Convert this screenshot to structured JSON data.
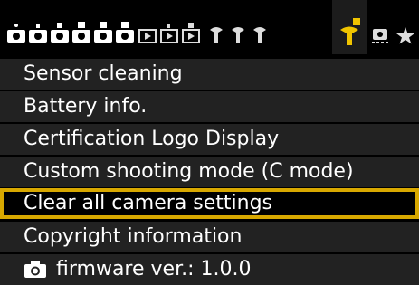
{
  "tabs": [
    {
      "icon": "camera-shooting-tab-icon",
      "index": "1",
      "selected": false
    },
    {
      "icon": "camera-shooting-tab-icon",
      "index": "2",
      "selected": false
    },
    {
      "icon": "camera-shooting-tab-icon",
      "index": "3",
      "selected": false
    },
    {
      "icon": "camera-shooting-tab-icon",
      "index": "4",
      "selected": false
    },
    {
      "icon": "camera-shooting-tab-icon",
      "index": "5",
      "selected": false
    },
    {
      "icon": "camera-shooting-tab-icon",
      "index": "6",
      "selected": false
    },
    {
      "icon": "playback-tab-icon",
      "index": "1",
      "selected": false
    },
    {
      "icon": "playback-tab-icon",
      "index": "2",
      "selected": false
    },
    {
      "icon": "playback-tab-icon",
      "index": "3",
      "selected": false
    },
    {
      "icon": "setup-tab-icon",
      "index": "1",
      "selected": false
    },
    {
      "icon": "setup-tab-icon",
      "index": "2",
      "selected": false
    },
    {
      "icon": "setup-tab-icon",
      "index": "3",
      "selected": false
    },
    {
      "icon": "setup-tab-icon",
      "index": "4",
      "selected": true
    },
    {
      "icon": "custom-functions-tab-icon",
      "index": "",
      "selected": false
    },
    {
      "icon": "my-menu-star-icon",
      "index": "",
      "selected": false
    }
  ],
  "menu": {
    "items": [
      {
        "label": "Sensor cleaning"
      },
      {
        "label": "Battery info."
      },
      {
        "label": "Certification Logo Display"
      },
      {
        "label": "Custom shooting mode (C mode)"
      },
      {
        "label": "Clear all camera settings",
        "selected": true
      },
      {
        "label": "Copyright information"
      },
      {
        "label": "firmware ver.: 1.0.0",
        "icon": "camera-icon"
      }
    ]
  },
  "colors": {
    "selection": "#d8a800",
    "setup_tab": "#f0c400",
    "shooting_tab": "#ffffff"
  }
}
